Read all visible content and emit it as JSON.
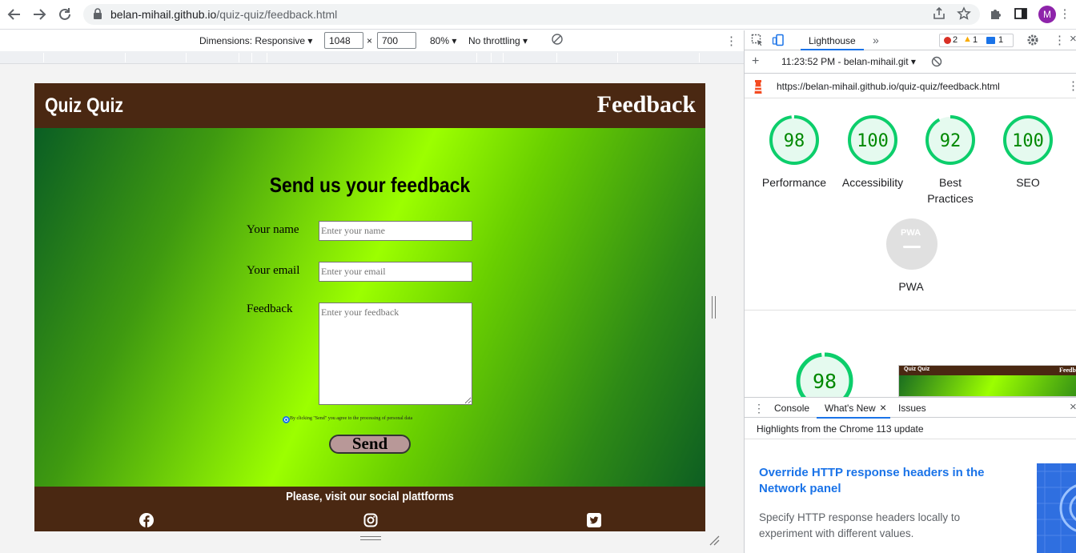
{
  "browser": {
    "url_host": "belan-mihail.github.io",
    "url_path": "/quiz-quiz/feedback.html",
    "profile_initial": "M"
  },
  "device_toolbar": {
    "dimensions_label": "Dimensions: Responsive",
    "width": "1048",
    "height": "700",
    "times": "×",
    "zoom": "80%",
    "throttling": "No throttling"
  },
  "site": {
    "logo": "Quiz Quiz",
    "page_title": "Feedback",
    "form_title": "Send us your feedback",
    "name_label": "Your name",
    "name_placeholder": "Enter your name",
    "email_label": "Your email",
    "email_placeholder": "Enter your email",
    "feedback_label": "Feedback",
    "feedback_placeholder": "Enter your feedback",
    "consent_text": "By clicking \"Send\" you agree to the processing of personal data",
    "send_label": "Send",
    "footer_text": "Please, visit our social plattforms",
    "social_icons": [
      "facebook-icon",
      "instagram-icon",
      "twitter-icon"
    ],
    "colors": {
      "header_bg": "#4a2812",
      "gradient_light": "#9cff00",
      "gradient_dark": "#0a5e24",
      "send_bg": "#b89898"
    }
  },
  "devtools": {
    "active_tab": "Lighthouse",
    "more_tabs": "»",
    "errors": "2",
    "warnings": "1",
    "messages": "1",
    "report_time": "11:23:52 PM - belan-mihail.git",
    "report_url": "https://belan-mihail.github.io/quiz-quiz/feedback.html",
    "scores": [
      {
        "label": "Performance",
        "value": "98"
      },
      {
        "label": "Accessibility",
        "value": "100"
      },
      {
        "label": "Best Practices",
        "value": "92"
      },
      {
        "label": "SEO",
        "value": "100"
      }
    ],
    "pwa_label": "PWA",
    "pwa_badge": "PWA",
    "detail_score": "98",
    "thumb_logo": "Quiz Quiz",
    "thumb_title": "Feedb",
    "drawer_tabs": [
      "Console",
      "What's New",
      "Issues"
    ],
    "drawer_active": "What's New",
    "highlights": "Highlights from the Chrome 113 update",
    "article_title": "Override HTTP response headers in the Network panel",
    "article_body": "Specify HTTP response headers locally to experiment with different values.",
    "colors": {
      "good": "#0cce6b",
      "good_text": "#008800",
      "accent": "#1a73e8"
    }
  }
}
